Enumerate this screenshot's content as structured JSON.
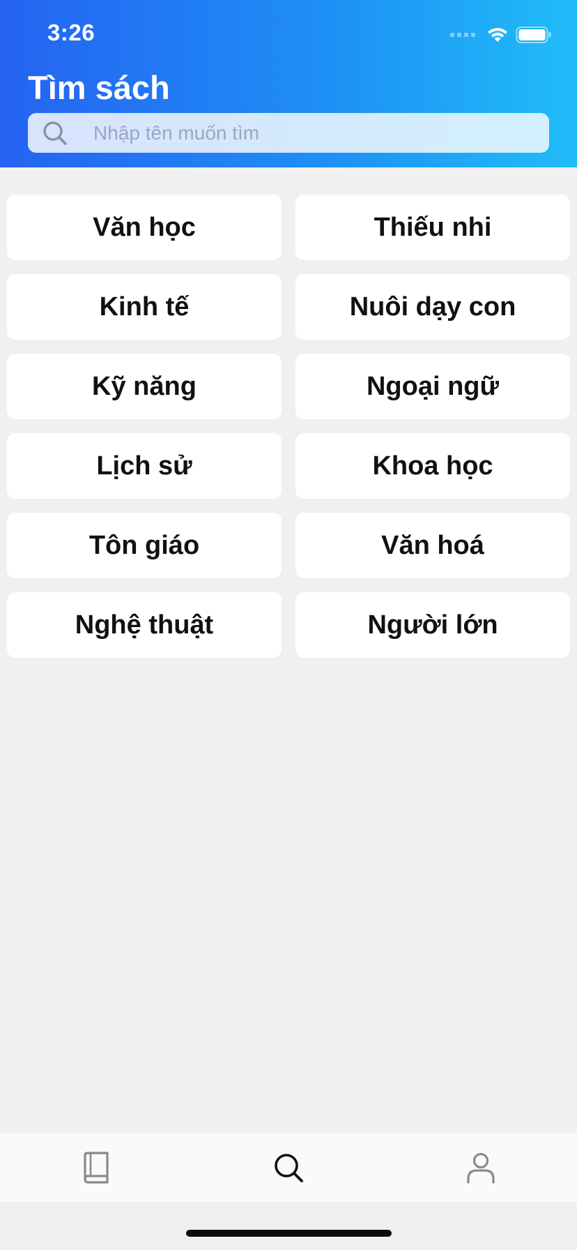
{
  "status_bar": {
    "time": "3:26"
  },
  "header": {
    "title": "Tìm sách",
    "gradient_start": "#2563f2",
    "gradient_end": "#20bcf8"
  },
  "search": {
    "placeholder": "Nhập tên muốn tìm",
    "value": "",
    "icon": "search-icon"
  },
  "categories": [
    "Văn học",
    "Thiếu nhi",
    "Kinh tế",
    "Nuôi dạy con",
    "Kỹ năng",
    "Ngoại ngữ",
    "Lịch sử",
    "Khoa học",
    "Tôn giáo",
    "Văn hoá",
    "Nghệ thuật",
    "Người lớn"
  ],
  "tab_bar": {
    "items": [
      {
        "icon": "book-icon",
        "active": false
      },
      {
        "icon": "search-icon",
        "active": true
      },
      {
        "icon": "user-icon",
        "active": false
      }
    ]
  }
}
